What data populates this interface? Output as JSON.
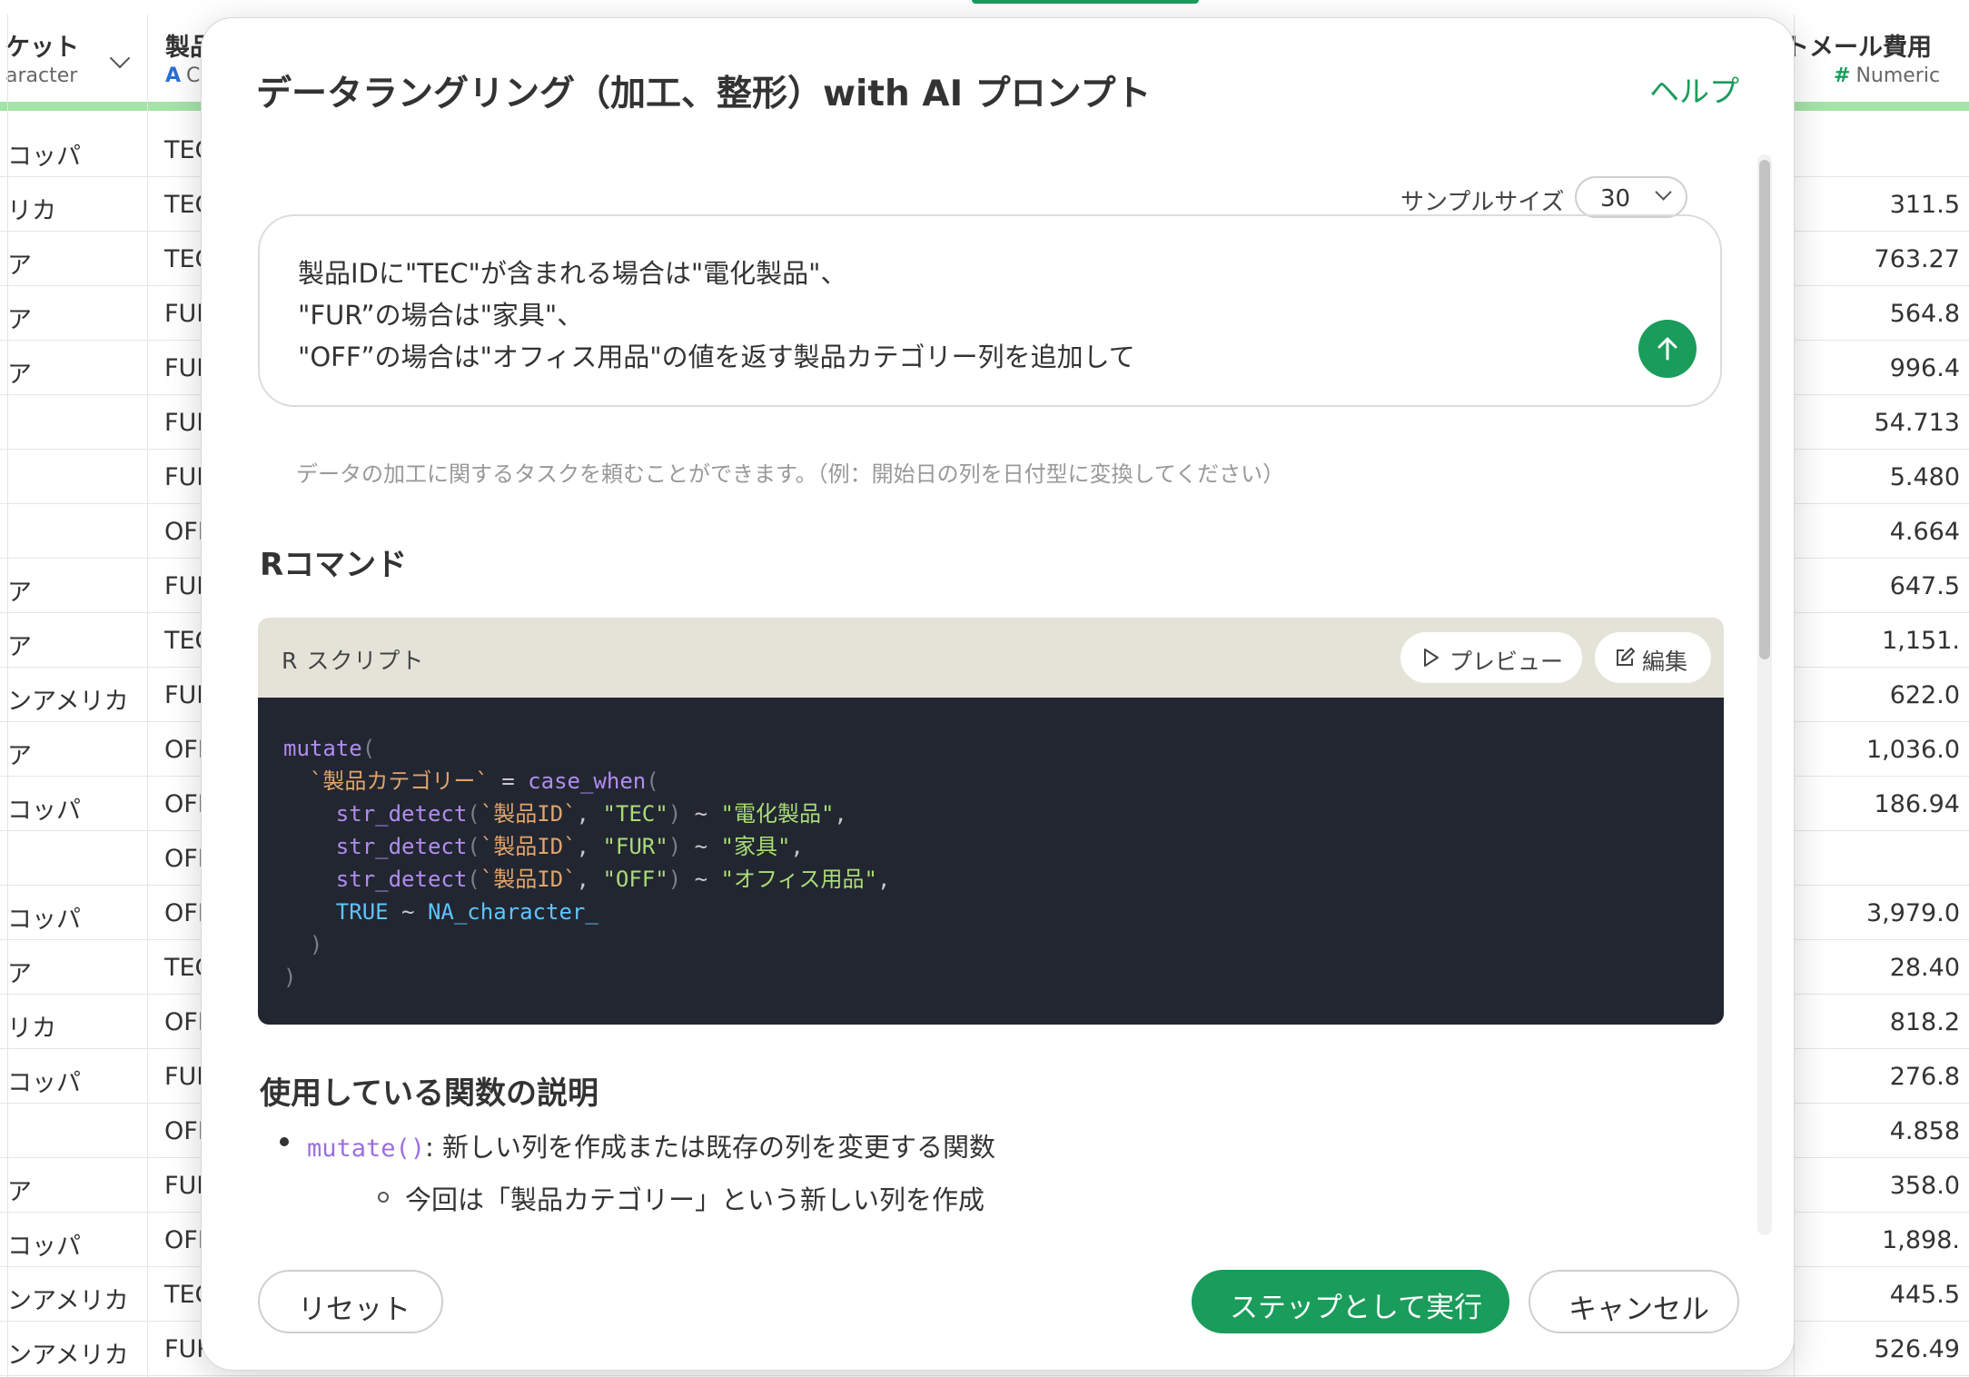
{
  "table": {
    "columns": [
      {
        "name": "ケット",
        "type_icon": "A",
        "type_label": "aracter"
      },
      {
        "name": "製品",
        "type_icon": "A",
        "type_label": "C"
      },
      {
        "name": "トメール費用",
        "type_icon": "#",
        "type_label": "Numeric"
      }
    ],
    "rows": [
      [
        "コッパ",
        "TEC",
        ""
      ],
      [
        "リカ",
        "TEC",
        "311.5"
      ],
      [
        "ア",
        "TEC",
        "763.27"
      ],
      [
        "ア",
        "FUR",
        "564.8"
      ],
      [
        "ア",
        "FUR",
        "996.4"
      ],
      [
        "",
        "FUR",
        "54.713"
      ],
      [
        "",
        "FUR",
        "5.480"
      ],
      [
        "",
        "OFF",
        "4.664"
      ],
      [
        "ア",
        "FUR",
        "647.5"
      ],
      [
        "ア",
        "TEC",
        "1,151."
      ],
      [
        "ンアメリカ",
        "FUR",
        "622.0"
      ],
      [
        "ア",
        "OFF",
        "1,036.0"
      ],
      [
        "コッパ",
        "OFF",
        "186.94"
      ],
      [
        "",
        "OFF",
        ""
      ],
      [
        "コッパ",
        "OFF",
        "3,979.0"
      ],
      [
        "ア",
        "TEC",
        "28.40"
      ],
      [
        "リカ",
        "OFF",
        "818.2"
      ],
      [
        "コッパ",
        "FUR",
        "276.8"
      ],
      [
        "",
        "OFF",
        "4.858"
      ],
      [
        "ア",
        "FUR",
        "358.0"
      ],
      [
        "コッパ",
        "OFF",
        "1,898."
      ],
      [
        "ンアメリカ",
        "TEC",
        "445.5"
      ],
      [
        "ンアメリカ",
        "FUR",
        "526.49"
      ]
    ]
  },
  "modal": {
    "title": "データラングリング（加工、整形）with AI プロンプト",
    "help_label": "ヘルプ",
    "sample_size_label": "サンプルサイズ",
    "sample_size_value": "30",
    "prompt_text": "製品IDに\"TEC\"が含まれる場合は\"電化製品\"、\n\"FUR”の場合は\"家具\"、\n\"OFF”の場合は\"オフィス用品\"の値を返す製品カテゴリー列を追加して",
    "hint": "データの加工に関するタスクを頼むことができます。（例：開始日の列を日付型に変換してください）",
    "r_command_heading": "Rコマンド",
    "script_title": "R スクリプト",
    "preview_label": "プレビュー",
    "edit_label": "編集",
    "code": {
      "fn_mutate": "mutate",
      "col_new": "`製品カテゴリー`",
      "fn_case_when": "case_when",
      "fn_str_detect": "str_detect",
      "col_id": "`製品ID`",
      "s_tec": "\"TEC\"",
      "s_fur": "\"FUR\"",
      "s_off": "\"OFF\"",
      "v_tec": "\"電化製品\"",
      "v_fur": "\"家具\"",
      "v_off": "\"オフィス用品\"",
      "k_true": "TRUE",
      "k_na": "NA_character_"
    },
    "functions_heading": "使用している関数の説明",
    "bullet_code": "mutate()",
    "bullet_text": ": 新しい列を作成または既存の列を変更する関数",
    "sub_bullet_text": "今回は「製品カテゴリー」という新しい列を作成",
    "reset_label": "リセット",
    "run_label": "ステップとして実行",
    "cancel_label": "キャンセル",
    "accent_color": "#1a9c5b"
  }
}
